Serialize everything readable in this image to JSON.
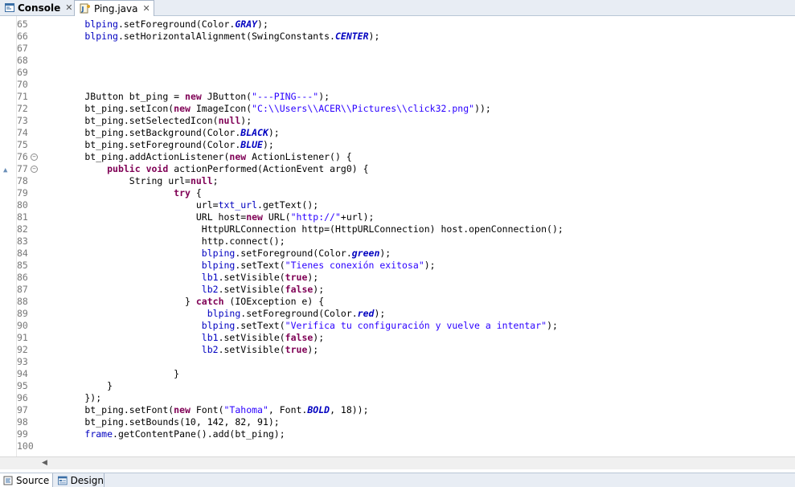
{
  "tabs": {
    "console": {
      "label": "Console",
      "close": "✕"
    },
    "ping": {
      "label": "Ping.java",
      "close": "✕"
    }
  },
  "bottom_tabs": {
    "source": "Source",
    "design": "Design"
  },
  "colors": {
    "keyword": "#7f0055",
    "field": "#0000c0",
    "string": "#2a00ff"
  },
  "lines": [
    {
      "n": "65",
      "parts": [
        {
          "t": "        "
        },
        {
          "t": "blping",
          "c": "fld"
        },
        {
          "t": ".setForeground(Color."
        },
        {
          "t": "GRAY",
          "c": "sfld"
        },
        {
          "t": ");"
        }
      ]
    },
    {
      "n": "66",
      "parts": [
        {
          "t": "        "
        },
        {
          "t": "blping",
          "c": "fld"
        },
        {
          "t": ".setHorizontalAlignment(SwingConstants."
        },
        {
          "t": "CENTER",
          "c": "sfld"
        },
        {
          "t": ");"
        }
      ]
    },
    {
      "n": "67",
      "parts": []
    },
    {
      "n": "68",
      "parts": []
    },
    {
      "n": "69",
      "parts": []
    },
    {
      "n": "70",
      "parts": []
    },
    {
      "n": "71",
      "parts": [
        {
          "t": "        JButton bt_ping = "
        },
        {
          "t": "new",
          "c": "kw"
        },
        {
          "t": " JButton("
        },
        {
          "t": "\"---PING---\"",
          "c": "str"
        },
        {
          "t": ");"
        }
      ]
    },
    {
      "n": "72",
      "parts": [
        {
          "t": "        bt_ping.setIcon("
        },
        {
          "t": "new",
          "c": "kw"
        },
        {
          "t": " ImageIcon("
        },
        {
          "t": "\"C:\\\\Users\\\\ACER\\\\Pictures\\\\click32.png\"",
          "c": "str"
        },
        {
          "t": "));"
        }
      ]
    },
    {
      "n": "73",
      "parts": [
        {
          "t": "        bt_ping.setSelectedIcon("
        },
        {
          "t": "null",
          "c": "kw"
        },
        {
          "t": ");"
        }
      ]
    },
    {
      "n": "74",
      "parts": [
        {
          "t": "        bt_ping.setBackground(Color."
        },
        {
          "t": "BLACK",
          "c": "sfld"
        },
        {
          "t": ");"
        }
      ]
    },
    {
      "n": "75",
      "parts": [
        {
          "t": "        bt_ping.setForeground(Color."
        },
        {
          "t": "BLUE",
          "c": "sfld"
        },
        {
          "t": ");"
        }
      ]
    },
    {
      "n": "76",
      "fold": true,
      "parts": [
        {
          "t": "        bt_ping.addActionListener("
        },
        {
          "t": "new",
          "c": "kw"
        },
        {
          "t": " ActionListener() {"
        }
      ]
    },
    {
      "n": "77",
      "fold": true,
      "warn": true,
      "parts": [
        {
          "t": "            "
        },
        {
          "t": "public",
          "c": "kw"
        },
        {
          "t": " "
        },
        {
          "t": "void",
          "c": "kw"
        },
        {
          "t": " actionPerformed(ActionEvent arg0) {"
        }
      ]
    },
    {
      "n": "78",
      "parts": [
        {
          "t": "                String url="
        },
        {
          "t": "null",
          "c": "kw"
        },
        {
          "t": ";"
        }
      ]
    },
    {
      "n": "79",
      "parts": [
        {
          "t": "                        "
        },
        {
          "t": "try",
          "c": "kw"
        },
        {
          "t": " {"
        }
      ]
    },
    {
      "n": "80",
      "parts": [
        {
          "t": "                            url="
        },
        {
          "t": "txt_url",
          "c": "fld"
        },
        {
          "t": ".getText();"
        }
      ]
    },
    {
      "n": "81",
      "parts": [
        {
          "t": "                            URL host="
        },
        {
          "t": "new",
          "c": "kw"
        },
        {
          "t": " URL("
        },
        {
          "t": "\"http://\"",
          "c": "str"
        },
        {
          "t": "+url);"
        }
      ]
    },
    {
      "n": "82",
      "parts": [
        {
          "t": "                             HttpURLConnection http=(HttpURLConnection) host.openConnection();"
        }
      ]
    },
    {
      "n": "83",
      "parts": [
        {
          "t": "                             http.connect();"
        }
      ]
    },
    {
      "n": "84",
      "parts": [
        {
          "t": "                             "
        },
        {
          "t": "blping",
          "c": "fld"
        },
        {
          "t": ".setForeground(Color."
        },
        {
          "t": "green",
          "c": "sfld"
        },
        {
          "t": ");"
        }
      ]
    },
    {
      "n": "85",
      "parts": [
        {
          "t": "                             "
        },
        {
          "t": "blping",
          "c": "fld"
        },
        {
          "t": ".setText("
        },
        {
          "t": "\"Tienes conexión exitosa\"",
          "c": "str"
        },
        {
          "t": ");"
        }
      ]
    },
    {
      "n": "86",
      "parts": [
        {
          "t": "                             "
        },
        {
          "t": "lb1",
          "c": "fld"
        },
        {
          "t": ".setVisible("
        },
        {
          "t": "true",
          "c": "kw"
        },
        {
          "t": ");"
        }
      ]
    },
    {
      "n": "87",
      "parts": [
        {
          "t": "                             "
        },
        {
          "t": "lb2",
          "c": "fld"
        },
        {
          "t": ".setVisible("
        },
        {
          "t": "false",
          "c": "kw"
        },
        {
          "t": ");"
        }
      ]
    },
    {
      "n": "88",
      "parts": [
        {
          "t": "                          } "
        },
        {
          "t": "catch",
          "c": "kw"
        },
        {
          "t": " (IOException e) {"
        }
      ]
    },
    {
      "n": "89",
      "parts": [
        {
          "t": "                              "
        },
        {
          "t": "blping",
          "c": "fld"
        },
        {
          "t": ".setForeground(Color."
        },
        {
          "t": "red",
          "c": "sfld"
        },
        {
          "t": ");"
        }
      ]
    },
    {
      "n": "90",
      "parts": [
        {
          "t": "                             "
        },
        {
          "t": "blping",
          "c": "fld"
        },
        {
          "t": ".setText("
        },
        {
          "t": "\"Verifica tu configuración y vuelve a intentar\"",
          "c": "str"
        },
        {
          "t": ");"
        }
      ]
    },
    {
      "n": "91",
      "parts": [
        {
          "t": "                             "
        },
        {
          "t": "lb1",
          "c": "fld"
        },
        {
          "t": ".setVisible("
        },
        {
          "t": "false",
          "c": "kw"
        },
        {
          "t": ");"
        }
      ]
    },
    {
      "n": "92",
      "parts": [
        {
          "t": "                             "
        },
        {
          "t": "lb2",
          "c": "fld"
        },
        {
          "t": ".setVisible("
        },
        {
          "t": "true",
          "c": "kw"
        },
        {
          "t": ");"
        }
      ]
    },
    {
      "n": "93",
      "parts": []
    },
    {
      "n": "94",
      "parts": [
        {
          "t": "                        }"
        }
      ]
    },
    {
      "n": "95",
      "parts": [
        {
          "t": "            }"
        }
      ]
    },
    {
      "n": "96",
      "parts": [
        {
          "t": "        });"
        }
      ]
    },
    {
      "n": "97",
      "parts": [
        {
          "t": "        bt_ping.setFont("
        },
        {
          "t": "new",
          "c": "kw"
        },
        {
          "t": " Font("
        },
        {
          "t": "\"Tahoma\"",
          "c": "str"
        },
        {
          "t": ", Font."
        },
        {
          "t": "BOLD",
          "c": "sfld"
        },
        {
          "t": ", 18));"
        }
      ]
    },
    {
      "n": "98",
      "parts": [
        {
          "t": "        bt_ping.setBounds(10, 142, 82, 91);"
        }
      ]
    },
    {
      "n": "99",
      "parts": [
        {
          "t": "        "
        },
        {
          "t": "frame",
          "c": "fld"
        },
        {
          "t": ".getContentPane().add(bt_ping);"
        }
      ]
    },
    {
      "n": "100",
      "parts": []
    }
  ]
}
